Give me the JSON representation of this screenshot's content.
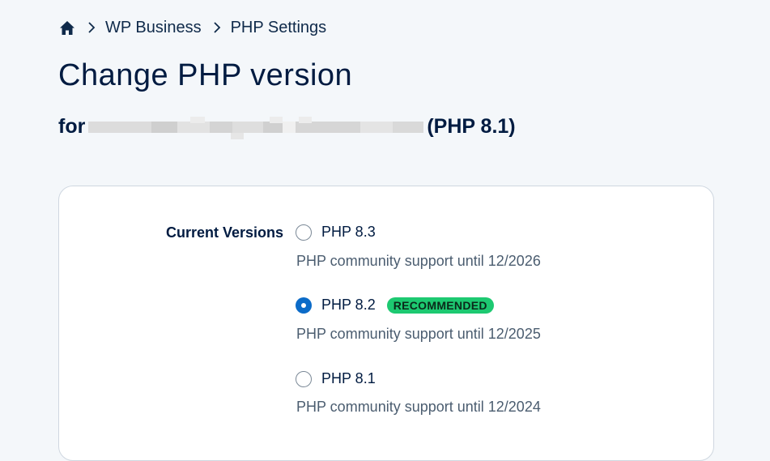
{
  "breadcrumb": {
    "home_icon": "home-icon",
    "separator_icon": "chevron-right-icon",
    "items": [
      "WP Business",
      "PHP Settings"
    ]
  },
  "page": {
    "title": "Change PHP version",
    "subtitle_prefix": "for",
    "subtitle_suffix": "(PHP 8.1)"
  },
  "form": {
    "label": "Current Versions",
    "options": [
      {
        "label": "PHP 8.3",
        "support": "PHP community support until 12/2026",
        "selected": false,
        "badge": ""
      },
      {
        "label": "PHP 8.2",
        "support": "PHP community support until 12/2025",
        "selected": true,
        "badge": "RECOMMENDED"
      },
      {
        "label": "PHP 8.1",
        "support": "PHP community support until 12/2024",
        "selected": false,
        "badge": ""
      }
    ]
  },
  "colors": {
    "background": "#f4f7fa",
    "text": "#001b41",
    "accent": "#0b6bc8",
    "badge": "#1dc971"
  }
}
